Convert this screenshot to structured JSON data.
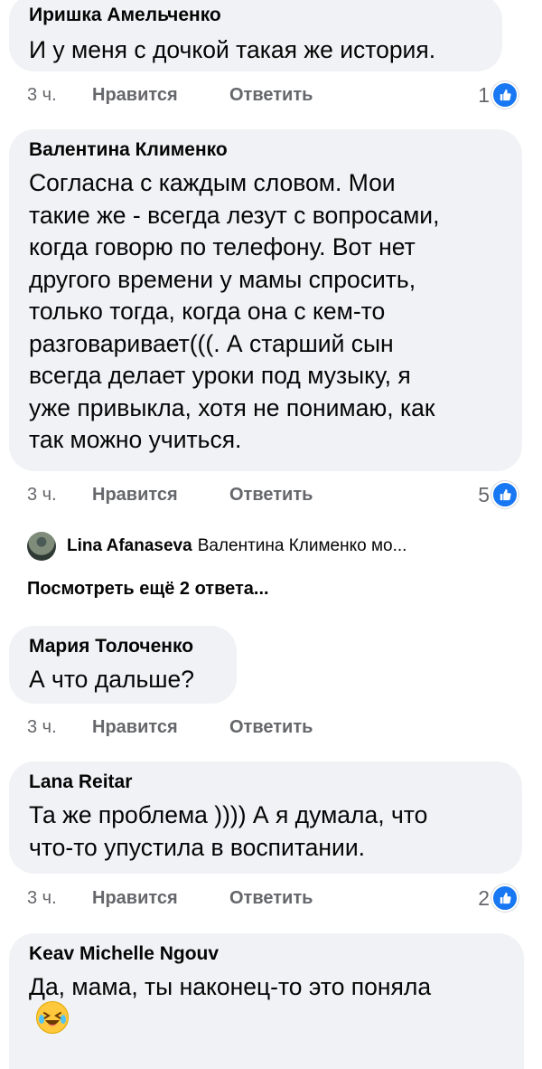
{
  "comments": [
    {
      "author": "Иришка Амельченко",
      "lines": [
        "И у меня с дочкой такая же история."
      ],
      "time": "3 ч.",
      "like": "Нравится",
      "reply": "Ответить",
      "reactions": "1"
    },
    {
      "author": "Валентина Клименко",
      "lines": [
        "Согласна с каждым словом. Мои",
        "такие же - всегда лезут с вопросами,",
        "когда говорю по телефону. Вот нет",
        "другого времени у мамы спросить,",
        "только тогда, когда она с кем-то",
        "разговаривает(((. А старший сын",
        "всегда делает уроки под музыку, я",
        "уже привыкла, хотя не понимаю, как",
        "так можно учиться."
      ],
      "time": "3 ч.",
      "like": "Нравится",
      "reply": "Ответить",
      "reactions": "5"
    },
    {
      "author": "Мария Толоченко",
      "lines": [
        "А что дальше?"
      ],
      "time": "3 ч.",
      "like": "Нравится",
      "reply": "Ответить"
    },
    {
      "author": "Lana Reitar",
      "lines": [
        "Та же проблема )))) А я думала, что",
        "что-то упустила в воспитании."
      ],
      "time": "3 ч.",
      "like": "Нравится",
      "reply": "Ответить",
      "reactions": "2"
    },
    {
      "author": "Keav Michelle Ngouv",
      "lines": [
        "Да, мама, ты наконец-то это поняла"
      ]
    }
  ],
  "reply_preview": {
    "author": "Lina Afanaseva",
    "snippet": "Валентина Клименко мо..."
  },
  "more_replies": "Посмотреть ещё 2 ответа...",
  "colors": {
    "bubble": "#f0f2f5",
    "meta": "#65676b",
    "like_badge": "#1877f2"
  },
  "icons": {
    "like": "thumbs-up-icon",
    "emoji": "laughing-emoji-icon"
  }
}
